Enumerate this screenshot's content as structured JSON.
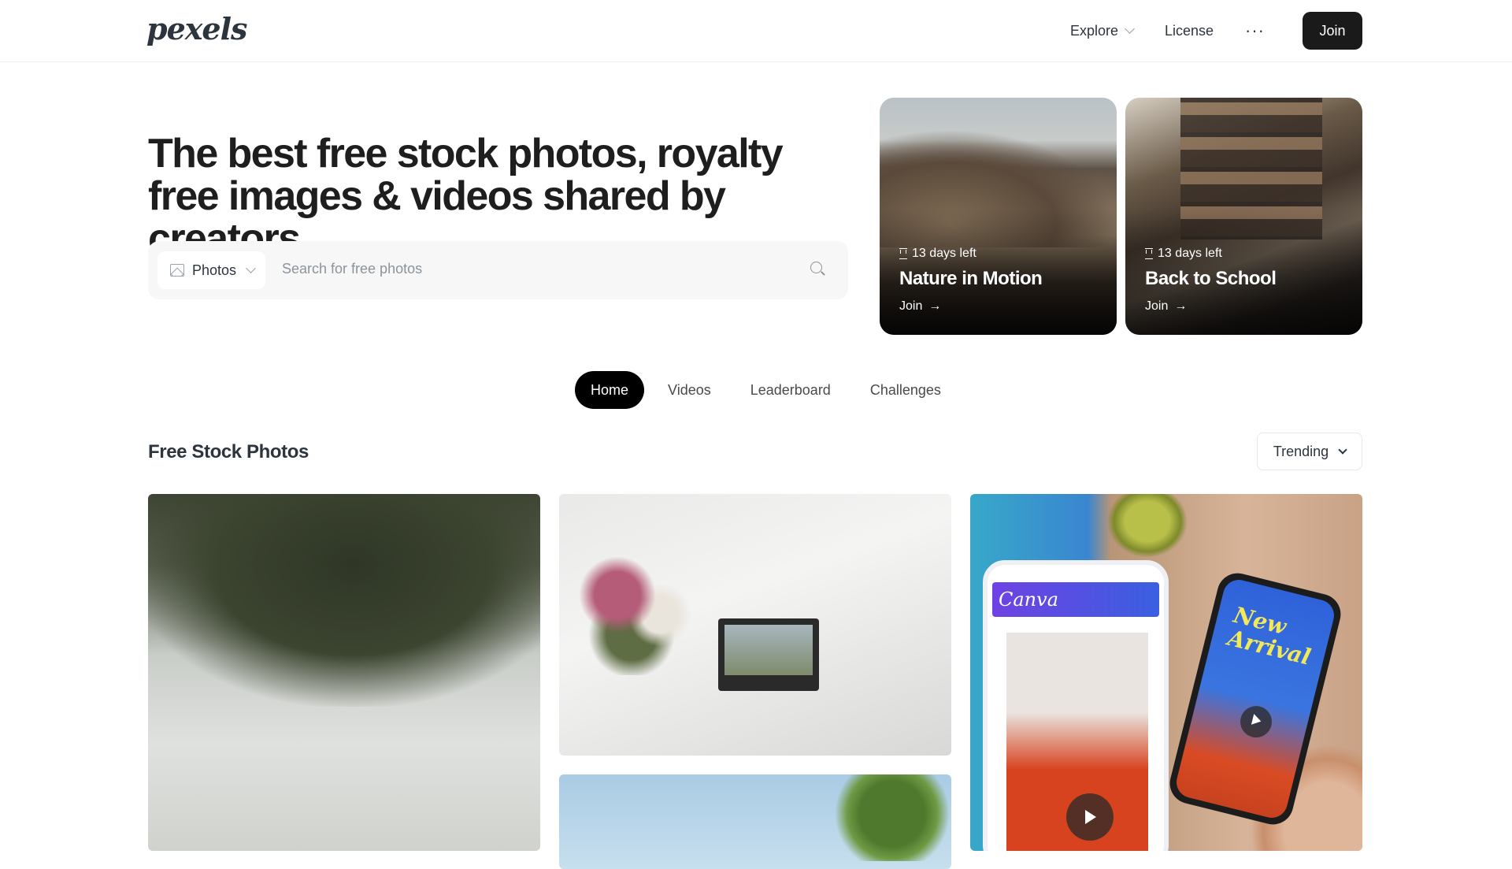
{
  "header": {
    "logo": "pexels",
    "nav": {
      "explore": "Explore",
      "license": "License",
      "more": "···",
      "join": "Join"
    }
  },
  "hero": {
    "title": "The best free stock photos, royalty free images & videos shared by creators.",
    "search": {
      "type_label": "Photos",
      "placeholder": "Search for free photos"
    }
  },
  "challenges": [
    {
      "days": "13 days left",
      "title": "Nature in Motion",
      "cta": "Join"
    },
    {
      "days": "13 days left",
      "title": "Back to School",
      "cta": "Join"
    }
  ],
  "tabs": [
    "Home",
    "Videos",
    "Leaderboard",
    "Challenges"
  ],
  "active_tab": "Home",
  "section": {
    "title": "Free Stock Photos",
    "sort": "Trending"
  },
  "photos": {
    "canva_brand": "Canva",
    "new_arrival": "New Arrival"
  },
  "colors": {
    "primary_dark": "#1a1a1a",
    "text": "#2c343e",
    "muted": "#8b939b",
    "search_bg": "#f7f7f7"
  }
}
